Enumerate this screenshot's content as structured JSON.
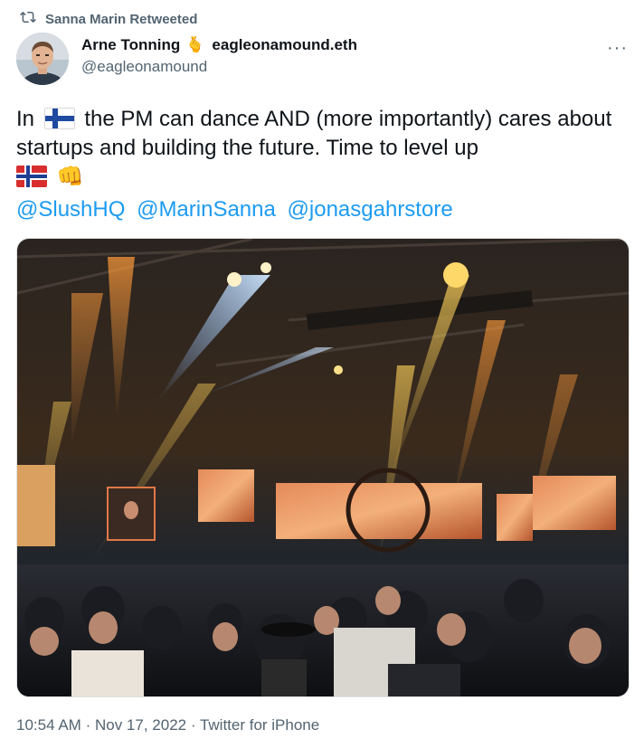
{
  "retweet": {
    "label": "Sanna Marin Retweeted",
    "icon": "retweet-icon"
  },
  "author": {
    "name": "Arne Tonning",
    "name_emoji": "🫰",
    "ens": "eagleonamound.eth",
    "handle": "@eagleonamound",
    "avatar_icon": "avatar-photo"
  },
  "more_label": "···",
  "tweet": {
    "part1": "In",
    "flag1": "finland-flag",
    "part2": "the PM can dance AND (more importantly) cares about startups and building the future. Time to level up",
    "flag2": "norway-flag",
    "emoji_end": "👊",
    "mentions": [
      "@SlushHQ",
      "@MarinSanna",
      "@jonasgahrstore"
    ]
  },
  "meta": {
    "time": "10:54 AM",
    "sep": "·",
    "date": "Nov 17, 2022",
    "client": "Twitter for iPhone"
  },
  "colors": {
    "link": "#1d9bf0",
    "muted": "#536471",
    "text": "#0f1419"
  }
}
